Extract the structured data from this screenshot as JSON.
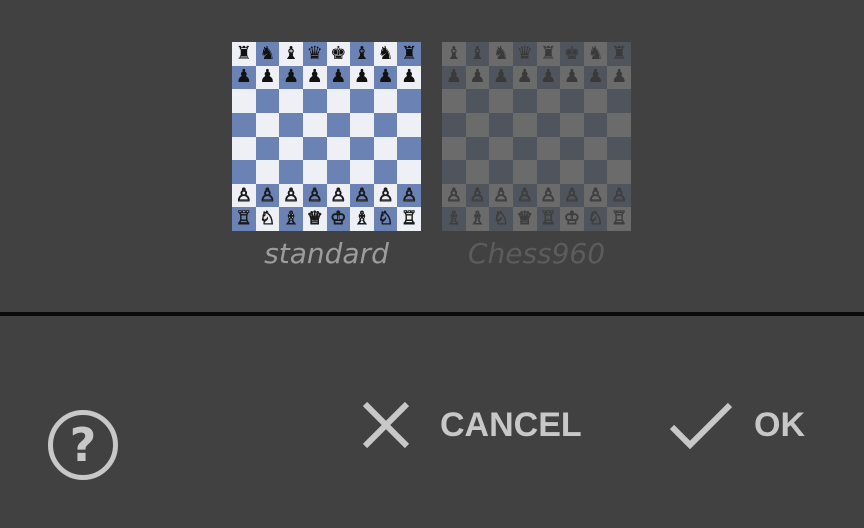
{
  "variants": [
    {
      "label": "standard",
      "rows": [
        [
          "♜",
          "♞",
          "♝",
          "♛",
          "♚",
          "♝",
          "♞",
          "♜"
        ],
        [
          "♟",
          "♟",
          "♟",
          "♟",
          "♟",
          "♟",
          "♟",
          "♟"
        ],
        [
          "",
          "",
          "",
          "",
          "",
          "",
          "",
          ""
        ],
        [
          "",
          "",
          "",
          "",
          "",
          "",
          "",
          ""
        ],
        [
          "",
          "",
          "",
          "",
          "",
          "",
          "",
          ""
        ],
        [
          "",
          "",
          "",
          "",
          "",
          "",
          "",
          ""
        ],
        [
          "♙",
          "♙",
          "♙",
          "♙",
          "♙",
          "♙",
          "♙",
          "♙"
        ],
        [
          "♖",
          "♘",
          "♗",
          "♕",
          "♔",
          "♗",
          "♘",
          "♖"
        ]
      ]
    },
    {
      "label": "Chess960",
      "rows": [
        [
          "♝",
          "♝",
          "♞",
          "♛",
          "♜",
          "♚",
          "♞",
          "♜"
        ],
        [
          "♟",
          "♟",
          "♟",
          "♟",
          "♟",
          "♟",
          "♟",
          "♟"
        ],
        [
          "",
          "",
          "",
          "",
          "",
          "",
          "",
          ""
        ],
        [
          "",
          "",
          "",
          "",
          "",
          "",
          "",
          ""
        ],
        [
          "",
          "",
          "",
          "",
          "",
          "",
          "",
          ""
        ],
        [
          "",
          "",
          "",
          "",
          "",
          "",
          "",
          ""
        ],
        [
          "♙",
          "♙",
          "♙",
          "♙",
          "♙",
          "♙",
          "♙",
          "♙"
        ],
        [
          "♗",
          "♗",
          "♘",
          "♕",
          "♖",
          "♔",
          "♘",
          "♖"
        ]
      ]
    }
  ],
  "footer": {
    "help_icon": "help-circle-icon",
    "cancel_label": "CANCEL",
    "cancel_icon": "close-icon",
    "ok_label": "OK",
    "ok_icon": "check-icon"
  },
  "colors": {
    "background": "#414141",
    "divider": "#0b0b0b",
    "action_text": "#c8c8c8",
    "board_light": "#eef0f6",
    "board_dark": "#6b82b4"
  }
}
